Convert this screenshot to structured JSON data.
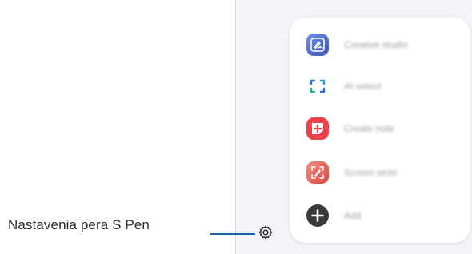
{
  "callout": {
    "label": "Nastavenia pera S Pen"
  },
  "air_command_menu": {
    "items": [
      {
        "label": "Creative studio",
        "icon": "creative-studio-icon",
        "color": "#4a67c9"
      },
      {
        "label": "AI select",
        "icon": "ai-select-icon",
        "color": "#2d6bd6"
      },
      {
        "label": "Create note",
        "icon": "create-note-icon",
        "color": "#e8424a"
      },
      {
        "label": "Screen write",
        "icon": "screen-write-icon",
        "color": "#e9655e"
      },
      {
        "label": "Add",
        "icon": "add-icon",
        "color": "#3a3a3c"
      }
    ]
  },
  "settings_button": {
    "icon": "gear-icon"
  },
  "colors": {
    "callout_line": "#1f5f9c",
    "panel_bg": "#f4f4f8"
  }
}
